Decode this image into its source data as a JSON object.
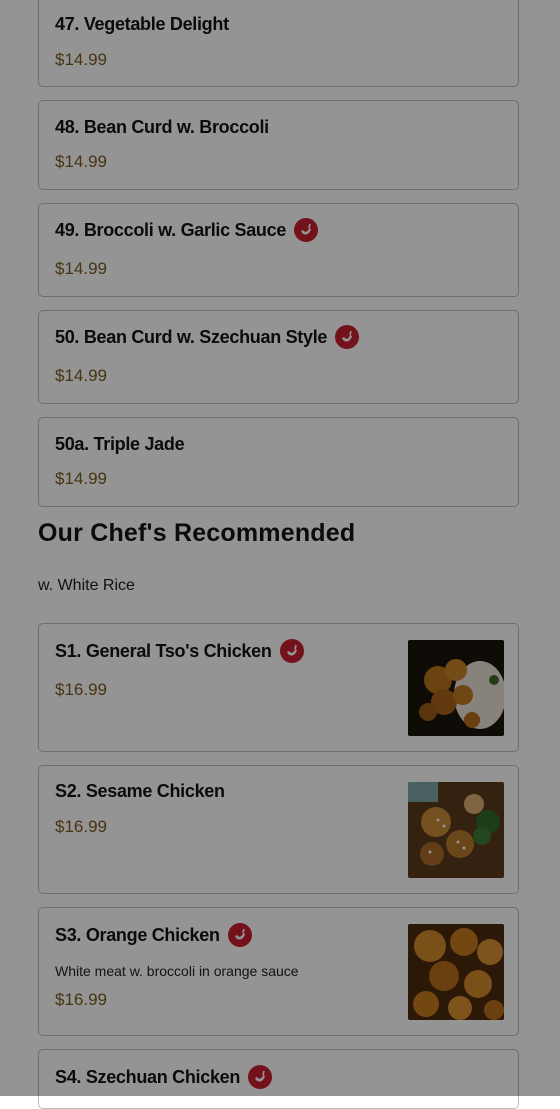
{
  "items_top": [
    {
      "name": "47. Vegetable Delight",
      "price": "$14.99",
      "spicy": false
    },
    {
      "name": "48. Bean Curd w. Broccoli",
      "price": "$14.99",
      "spicy": false
    },
    {
      "name": "49. Broccoli w. Garlic Sauce",
      "price": "$14.99",
      "spicy": true
    },
    {
      "name": "50. Bean Curd w. Szechuan Style",
      "price": "$14.99",
      "spicy": true
    },
    {
      "name": "50a. Triple Jade",
      "price": "$14.99",
      "spicy": false
    }
  ],
  "section": {
    "title": "Our Chef's Recommended",
    "subtitle": "w. White Rice"
  },
  "items_chef": [
    {
      "name": "S1. General Tso's Chicken",
      "price": "$16.99",
      "spicy": true,
      "image": "general-tsos-chicken-photo"
    },
    {
      "name": "S2. Sesame Chicken",
      "price": "$16.99",
      "spicy": false,
      "image": "sesame-chicken-photo"
    },
    {
      "name": "S3. Orange Chicken",
      "description": "White meat w. broccoli in orange sauce",
      "price": "$16.99",
      "spicy": true,
      "image": "orange-chicken-photo"
    },
    {
      "name": "S4. Szechuan Chicken",
      "spicy": true
    }
  ],
  "colors": {
    "spicy_icon": "#c8202f",
    "price": "#7a5a1e",
    "overlay": "rgba(0,0,0,0.42)"
  }
}
